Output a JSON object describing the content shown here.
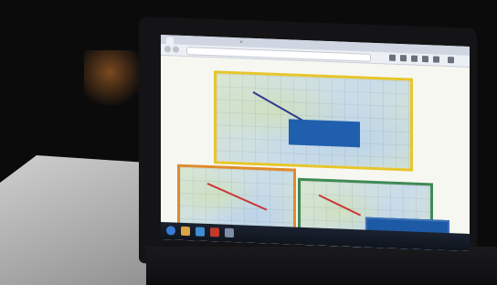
{
  "browser": {
    "tab_title": "",
    "address": ""
  },
  "slide": {
    "callout_top": "",
    "callout_bottom_right": ""
  },
  "taskbar": {
    "clock": ""
  },
  "colors": {
    "frame_top": "#e6c62c",
    "frame_bottom_left": "#e08b2a",
    "frame_bottom_right": "#3f8a55",
    "callout": "#1f5fae"
  },
  "icons": [
    "close-icon",
    "back-icon",
    "forward-icon",
    "refresh-icon",
    "windows-start-icon",
    "folder-icon",
    "browser-icon"
  ]
}
